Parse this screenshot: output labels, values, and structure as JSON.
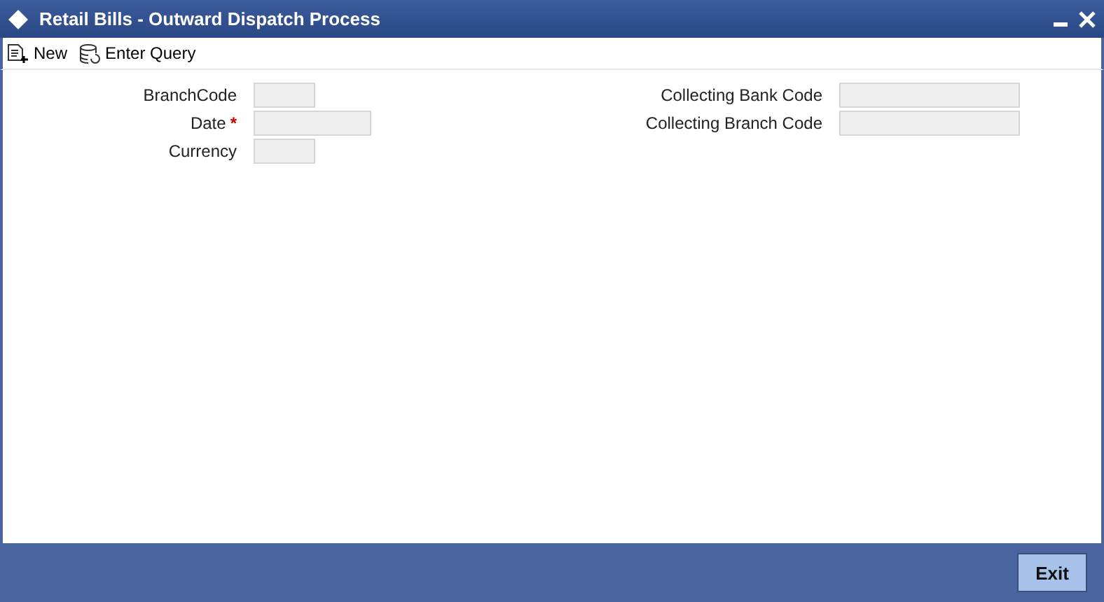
{
  "window": {
    "title": "Retail Bills - Outward Dispatch Process"
  },
  "toolbar": [
    {
      "kind": "new",
      "label": "New"
    },
    {
      "kind": "query",
      "label": "Enter Query"
    }
  ],
  "left_fields": [
    {
      "label": "BranchCode",
      "kind": "short"
    },
    {
      "label": "Date",
      "kind": "long",
      "marker": "*"
    },
    {
      "label": "Currency",
      "kind": "short"
    }
  ],
  "right_fields": [
    {
      "label": "Collecting Bank Code",
      "kind": "wide"
    },
    {
      "label": "Collecting Branch Code",
      "kind": "wide"
    }
  ],
  "buttons": [
    "Exit"
  ]
}
